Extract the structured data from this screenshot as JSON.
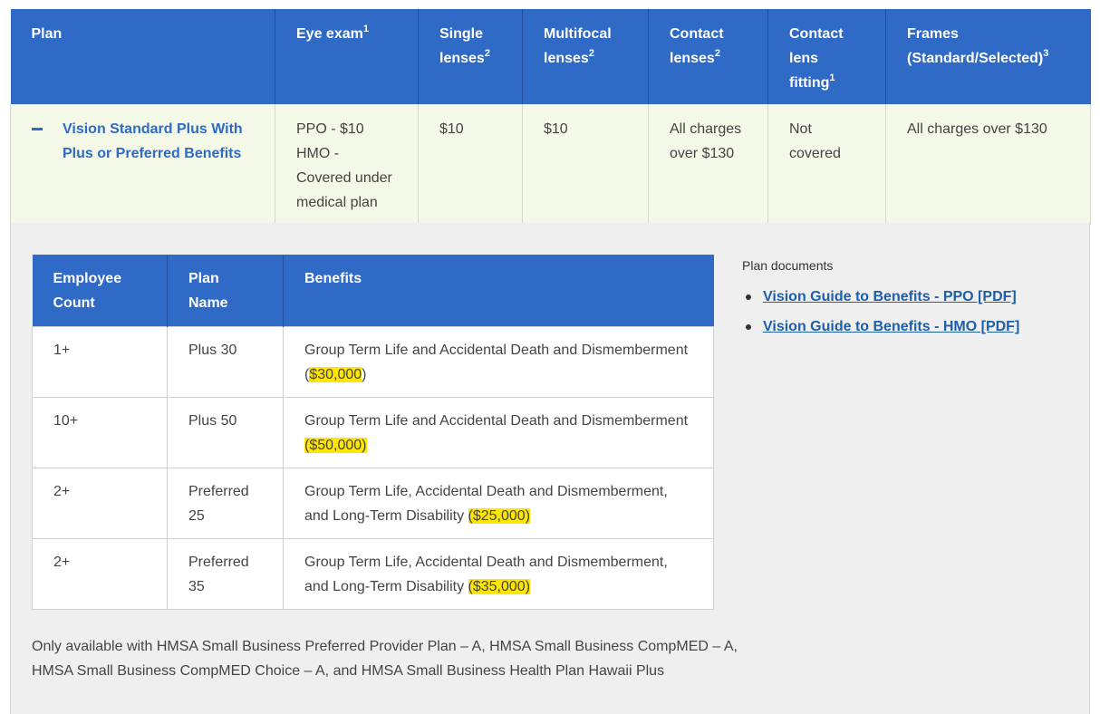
{
  "top_table": {
    "headers": [
      {
        "label": "Plan",
        "sup": ""
      },
      {
        "label": "Eye exam",
        "sup": "1"
      },
      {
        "label": "Single lenses",
        "sup": "2"
      },
      {
        "label": "Multifocal lenses",
        "sup": "2"
      },
      {
        "label": "Contact lenses",
        "sup": "2"
      },
      {
        "label": "Contact lens fitting",
        "sup": "1"
      },
      {
        "label": "Frames (Standard/Selected)",
        "sup": "3"
      }
    ],
    "row": {
      "plan": "Vision Standard Plus With Plus or Preferred Benefits",
      "eye_exam_line1": "PPO - $10",
      "eye_exam_line2": "HMO - Covered under medical plan",
      "single_lenses": "$10",
      "multifocal_lenses": "$10",
      "contact_lenses": "All charges over $130",
      "contact_lens_fitting": "Not covered",
      "frames": "All charges over $130"
    }
  },
  "benefit_table": {
    "headers": [
      "Employee Count",
      "Plan Name",
      "Benefits"
    ],
    "rows": [
      {
        "count": "1+",
        "plan": "Plus 30",
        "benefit": "Group Term Life and Accidental Death and Dismemberment (",
        "amount": "$30,000",
        "close": ")"
      },
      {
        "count": "10+",
        "plan": "Plus 50",
        "benefit": "Group Term Life and Accidental Death and Dismemberment ",
        "amount": "($50,000)",
        "close": ""
      },
      {
        "count": "2+",
        "plan": "Preferred 25",
        "benefit": "Group Term Life, Accidental Death and Dismemberment, and Long-Term Disability ",
        "amount": "($25,000)",
        "close": ""
      },
      {
        "count": "2+",
        "plan": "Preferred 35",
        "benefit": "Group Term Life, Accidental Death and Dismemberment, and Long-Term Disability ",
        "amount": "($35,000)",
        "close": ""
      }
    ],
    "highlight_color": "#ffe600"
  },
  "plan_documents": {
    "title": "Plan documents",
    "links": [
      "Vision Guide to Benefits - PPO [PDF]",
      "Vision Guide to Benefits - HMO [PDF]"
    ]
  },
  "footnote": "Only available with HMSA Small Business Preferred Provider Plan – A, HMSA Small Business CompMED – A, HMSA Small Business CompMED Choice – A, and HMSA Small Business Health Plan Hawaii Plus",
  "colors": {
    "header_blue": "#2f6ac7",
    "row_green": "#f4f8e6",
    "panel_gray": "#efefef",
    "link_blue": "#1d5fa8"
  }
}
